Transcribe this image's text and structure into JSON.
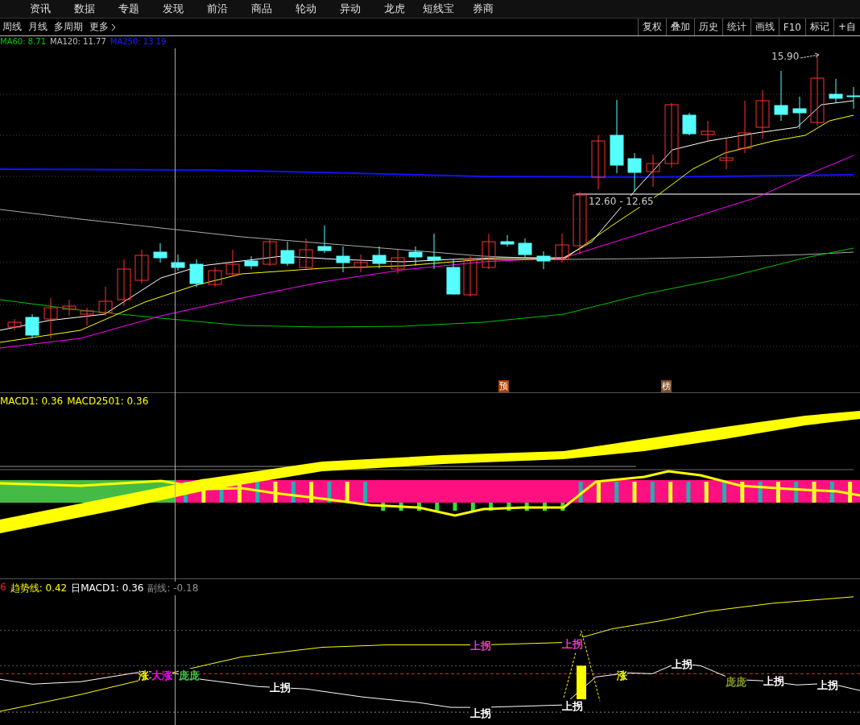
{
  "menu": [
    {
      "label": "资讯"
    },
    {
      "label": "数据"
    },
    {
      "label": "专题"
    },
    {
      "label": "发现"
    },
    {
      "label": "前沿"
    },
    {
      "label": "商品"
    },
    {
      "label": "轮动"
    },
    {
      "label": "异动"
    },
    {
      "label": "龙虎"
    },
    {
      "label": "短线宝"
    },
    {
      "label": "券商"
    }
  ],
  "periods": [
    {
      "label": "周线"
    },
    {
      "label": "月线"
    },
    {
      "label": "多周期"
    },
    {
      "label": "更多"
    }
  ],
  "tools": [
    {
      "label": "复权"
    },
    {
      "label": "叠加"
    },
    {
      "label": "历史"
    },
    {
      "label": "统计"
    },
    {
      "label": "画线"
    },
    {
      "label": "F10"
    },
    {
      "label": "标记"
    },
    {
      "label": "+自"
    }
  ],
  "main_panel": {
    "legend": [
      {
        "text": "MA60: 8.71",
        "color": "#00d000"
      },
      {
        "text": "MA120: 11.77",
        "color": "#c0c0c0"
      },
      {
        "text": "MA250: 13.19",
        "color": "#2020ff"
      }
    ],
    "high_label": "15.90",
    "range_label": "12.60 - 12.65",
    "markers": [
      {
        "label": "预",
        "color": "#b04000"
      },
      {
        "label": "榜",
        "color": "#805030"
      }
    ]
  },
  "macd_panel": {
    "legend": [
      {
        "text": "MACD1: 0.36",
        "color": "#ffff00"
      },
      {
        "text": "MACD2501: 0.36",
        "color": "#ffff00"
      }
    ]
  },
  "trend_panel": {
    "legend": [
      {
        "text": "6",
        "color": "#ff2020"
      },
      {
        "text": "趋势线: 0.42",
        "color": "#ffff00"
      },
      {
        "text": "日MACD1: 0.36",
        "color": "#ffffff"
      },
      {
        "text": "副线: -0.18",
        "color": "#909090"
      }
    ],
    "annotations": [
      {
        "text": "涨",
        "color": "#ffff00"
      },
      {
        "text": "大涨",
        "color": "#ff00ff"
      },
      {
        "text": "庞庞",
        "color": "#40c040"
      },
      {
        "text": "上拐",
        "color": "#ffffff"
      },
      {
        "text": "上拐",
        "color": "#e040c0"
      },
      {
        "text": "上拐",
        "color": "#e040c0"
      },
      {
        "text": "上拐",
        "color": "#ffffff"
      },
      {
        "text": "上拐",
        "color": "#ffffff"
      },
      {
        "text": "涨",
        "color": "#ffff00"
      },
      {
        "text": "上拐",
        "color": "#ffffff"
      },
      {
        "text": "庞庞",
        "color": "#809020"
      },
      {
        "text": "上拐",
        "color": "#ffffff"
      },
      {
        "text": "上拐",
        "color": "#ffffff"
      }
    ]
  }
}
